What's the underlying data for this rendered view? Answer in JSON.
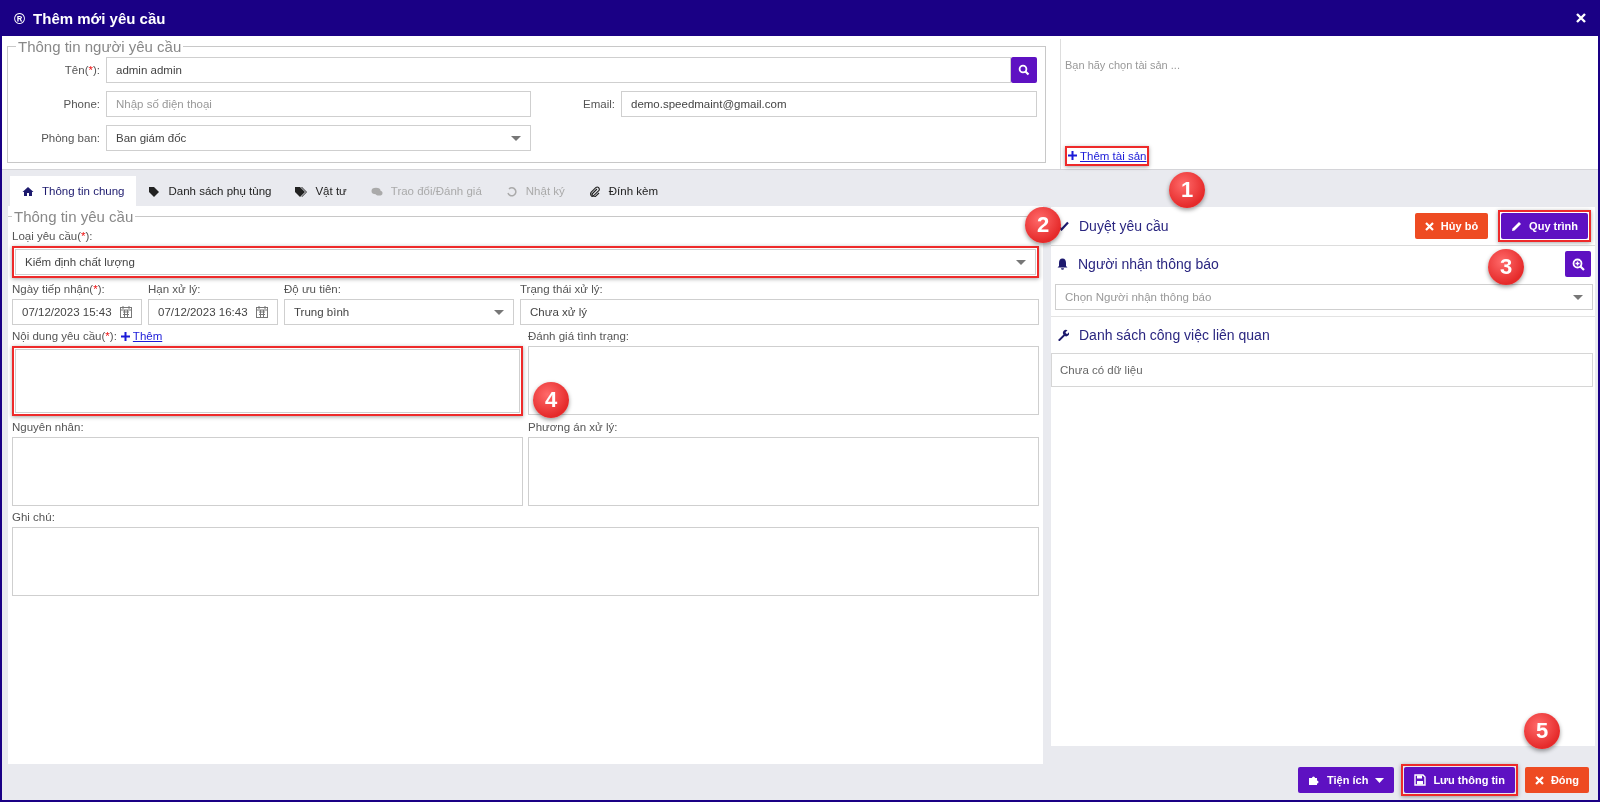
{
  "window": {
    "logo": "®",
    "title": "Thêm mới yêu cầu"
  },
  "requester": {
    "legend": "Thông tin người yêu cầu",
    "name": {
      "label": "Tên(",
      "mark": "*",
      "label_end": "):",
      "value": "admin admin"
    },
    "phone": {
      "label": "Phone:",
      "placeholder": "Nhập số điện thoại"
    },
    "email": {
      "label": "Email:",
      "value": "demo.speedmaint@gmail.com"
    },
    "department": {
      "label": "Phòng ban:",
      "value": "Ban giám đốc"
    }
  },
  "asset_panel": {
    "placeholder": "Bạn hãy chọn tài sản ...",
    "add_link": {
      "label": "Thêm tài sản",
      "highlighted": true
    }
  },
  "tabs": [
    {
      "label": "Thông tin chung",
      "selected": true,
      "disabled": false
    },
    {
      "label": "Danh sách phụ tùng",
      "selected": false,
      "disabled": false
    },
    {
      "label": "Vật tư",
      "selected": false,
      "disabled": false
    },
    {
      "label": "Trao đổi/Đánh giá",
      "selected": false,
      "disabled": true
    },
    {
      "label": "Nhật ký",
      "selected": false,
      "disabled": true
    },
    {
      "label": "Đính kèm",
      "selected": false,
      "disabled": false
    }
  ],
  "request": {
    "legend": "Thông tin yêu cầu",
    "type": {
      "label": "Loại yêu cầu(",
      "mark": "*",
      "label_end": "):",
      "value": "Kiểm định chất lượng",
      "highlighted": true
    },
    "received": {
      "label": "Ngày tiếp nhận(",
      "mark": "*",
      "label_end": "):",
      "value": "07/12/2023 15:43"
    },
    "deadline": {
      "label": "Hạn xử lý:",
      "value": "07/12/2023 16:43"
    },
    "priority": {
      "label": "Độ ưu tiên:",
      "value": "Trung bình"
    },
    "status": {
      "label": "Trạng thái xử lý:",
      "value": "Chưa xử lý"
    },
    "content": {
      "label": "Nội dung yêu cầu(",
      "mark": "*",
      "label_end": "):",
      "add_link": "Thêm",
      "highlighted": true
    },
    "assessment": {
      "label": "Đánh giá tình trạng:"
    },
    "cause": {
      "label": "Nguyên nhân:"
    },
    "solution": {
      "label": "Phương án xử lý:"
    },
    "note": {
      "label": "Ghi chú:"
    }
  },
  "approval": {
    "title": "Duyệt yêu cầu",
    "cancel": "Hủy bỏ",
    "workflow": {
      "label": "Quy trình",
      "highlighted": true
    }
  },
  "notify": {
    "title": "Người nhận thông báo",
    "placeholder": "Chọn Người nhận thông báo"
  },
  "related": {
    "title": "Danh sách công việc liên quan",
    "empty": "Chưa có dữ liệu"
  },
  "footer": {
    "buttons": [
      {
        "kind": "menu",
        "label": "Tiện ích",
        "highlighted": false
      },
      {
        "kind": "save",
        "label": "Lưu thông tin",
        "highlighted": true
      },
      {
        "kind": "close",
        "label": "Đóng",
        "highlighted": false
      }
    ]
  },
  "callouts": [
    "1",
    "2",
    "3",
    "4",
    "5"
  ]
}
